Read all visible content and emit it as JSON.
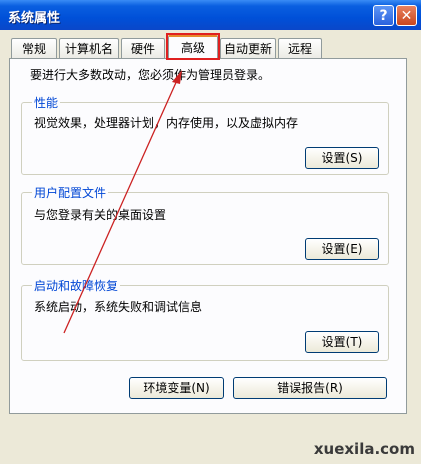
{
  "window": {
    "title": "系统属性",
    "help_glyph": "?",
    "close_glyph": "✕"
  },
  "tabs": [
    {
      "label": "常规"
    },
    {
      "label": "计算机名"
    },
    {
      "label": "硬件"
    },
    {
      "label": "高级",
      "active": true
    },
    {
      "label": "自动更新"
    },
    {
      "label": "远程"
    }
  ],
  "notice": "要进行大多数改动，您必须作为管理员登录。",
  "groups": {
    "performance": {
      "title": "性能",
      "desc": "视觉效果，处理器计划，内存使用，以及虚拟内存",
      "button": "设置(S)"
    },
    "user_profiles": {
      "title": "用户配置文件",
      "desc": "与您登录有关的桌面设置",
      "button": "设置(E)"
    },
    "startup_recovery": {
      "title": "启动和故障恢复",
      "desc": "系统启动，系统失败和调试信息",
      "button": "设置(T)"
    }
  },
  "bottom_buttons": {
    "env_vars": "环境变量(N)",
    "error_report": "错误报告(R)"
  },
  "watermark": "xuexila.com",
  "colors": {
    "title_blue": "#0050d8",
    "group_title": "#0046d5",
    "highlight_red": "#e02020",
    "arrow_red": "#cc2222"
  }
}
